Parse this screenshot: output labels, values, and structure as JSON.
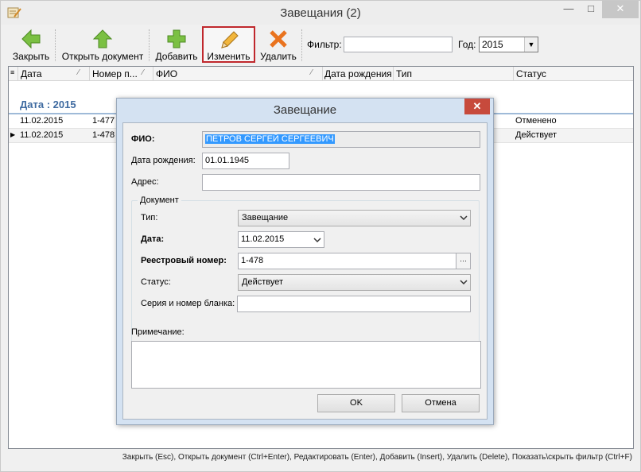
{
  "window": {
    "title": "Завещания (2)"
  },
  "toolbar": {
    "close_label": "Закрыть",
    "open_label": "Открыть документ",
    "add_label": "Добавить",
    "edit_label": "Изменить",
    "delete_label": "Удалить",
    "filter_label": "Фильтр:",
    "filter_value": "",
    "year_label": "Год:",
    "year_value": "2015"
  },
  "grid": {
    "columns": [
      "Дата",
      "Номер п...",
      "ФИО",
      "Дата рождения",
      "Тип",
      "Статус"
    ],
    "group_title": "Дата : 2015",
    "rows": [
      {
        "date": "11.02.2015",
        "number": "1-477",
        "status": "Отменено"
      },
      {
        "date": "11.02.2015",
        "number": "1-478",
        "status": "Действует"
      }
    ]
  },
  "status_bar": {
    "text": "Закрыть (Esc), Открыть документ (Ctrl+Enter), Редактировать (Enter), Добавить (Insert), Удалить (Delete), Показать\\скрыть фильтр (Ctrl+F)"
  },
  "dialog": {
    "title": "Завещание",
    "fio_label": "ФИО:",
    "fio_value": "ПЕТРОВ СЕРГЕЙ СЕРГЕЕВИЧ",
    "birth_label": "Дата рождения:",
    "birth_value": "01.01.1945",
    "address_label": "Адрес:",
    "address_value": "",
    "document_group": "Документ",
    "type_label": "Тип:",
    "type_value": "Завещание",
    "date_label": "Дата:",
    "date_value": "11.02.2015",
    "reg_label": "Реестровый номер:",
    "reg_value": "1-478",
    "status_label": "Статус:",
    "status_value": "Действует",
    "series_label": "Серия и номер бланка:",
    "series_value": "",
    "note_label": "Примечание:",
    "note_value": "",
    "ok_label": "OK",
    "cancel_label": "Отмена"
  },
  "colors": {
    "group_title": "#3e6aa0",
    "close_button": "#c74a3c",
    "active_border": "#c0282d"
  }
}
